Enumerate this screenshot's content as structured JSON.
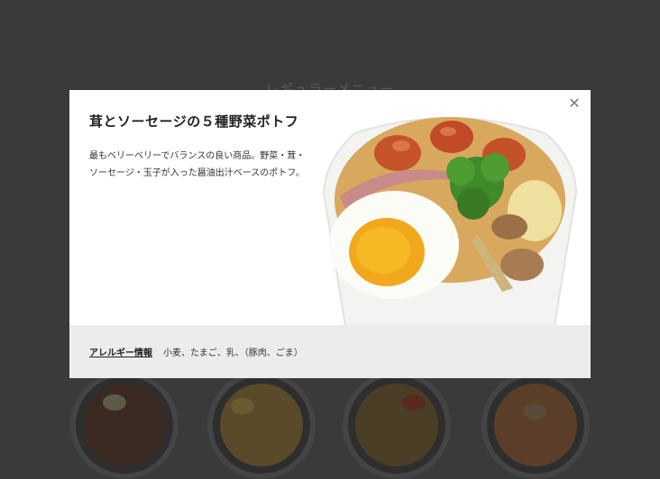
{
  "background": {
    "section_title": "レギュラーメニュー"
  },
  "modal": {
    "title": "茸とソーセージの５種野菜ポトフ",
    "description": "最もベリーベリーでバランスの良い商品。野菜・茸・ソーセージ・玉子が入った醤油出汁ベースのポトフ。",
    "close_icon": "close-icon",
    "allergy_label": "アレルギー情報",
    "allergy_items": "小麦、たまご、乳、（豚肉、ごま）"
  },
  "colors": {
    "overlay": "#3a3a3a",
    "modal_bg": "#ffffff",
    "footer_bg": "#ececec"
  }
}
